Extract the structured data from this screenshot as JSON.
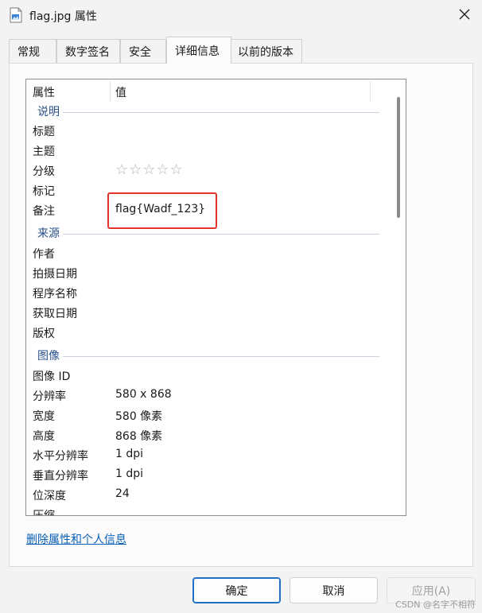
{
  "window": {
    "title": "flag.jpg 属性",
    "icon": "image-file-icon",
    "close_icon": "close-icon"
  },
  "tabs": [
    {
      "label": "常规",
      "active": false
    },
    {
      "label": "数字签名",
      "active": false
    },
    {
      "label": "安全",
      "active": false
    },
    {
      "label": "详细信息",
      "active": true
    },
    {
      "label": "以前的版本",
      "active": false
    }
  ],
  "details": {
    "header": {
      "property": "属性",
      "value": "值"
    },
    "groups": {
      "description": "说明",
      "origin": "来源",
      "image": "图像"
    },
    "rows": {
      "title": {
        "key": "标题",
        "value": ""
      },
      "subject": {
        "key": "主题",
        "value": ""
      },
      "rating": {
        "key": "分级",
        "stars": "☆☆☆☆☆",
        "value": 0
      },
      "tags": {
        "key": "标记",
        "value": ""
      },
      "comments": {
        "key": "备注",
        "value": "flag{Wadf_123}"
      },
      "authors": {
        "key": "作者",
        "value": ""
      },
      "date_taken": {
        "key": "拍摄日期",
        "value": ""
      },
      "program_name": {
        "key": "程序名称",
        "value": ""
      },
      "date_acquired": {
        "key": "获取日期",
        "value": ""
      },
      "copyright": {
        "key": "版权",
        "value": ""
      },
      "image_id": {
        "key": "图像 ID",
        "value": ""
      },
      "dimensions": {
        "key": "分辨率",
        "value": "580 x 868"
      },
      "width": {
        "key": "宽度",
        "value": "580 像素"
      },
      "height": {
        "key": "高度",
        "value": "868 像素"
      },
      "h_resolution": {
        "key": "水平分辨率",
        "value": "1 dpi"
      },
      "v_resolution": {
        "key": "垂直分辨率",
        "value": "1 dpi"
      },
      "bit_depth": {
        "key": "位深度",
        "value": "24"
      },
      "compression": {
        "key": "压缩",
        "value": ""
      }
    }
  },
  "remove_link": "删除属性和个人信息",
  "buttons": {
    "ok": "确定",
    "cancel": "取消",
    "apply": "应用(A)"
  },
  "watermark": "CSDN @名字不相符",
  "colors": {
    "highlight": "#e5332a",
    "link": "#0a5fb4",
    "group_title": "#2a4f8a",
    "primary_border": "#1f6fc5"
  }
}
